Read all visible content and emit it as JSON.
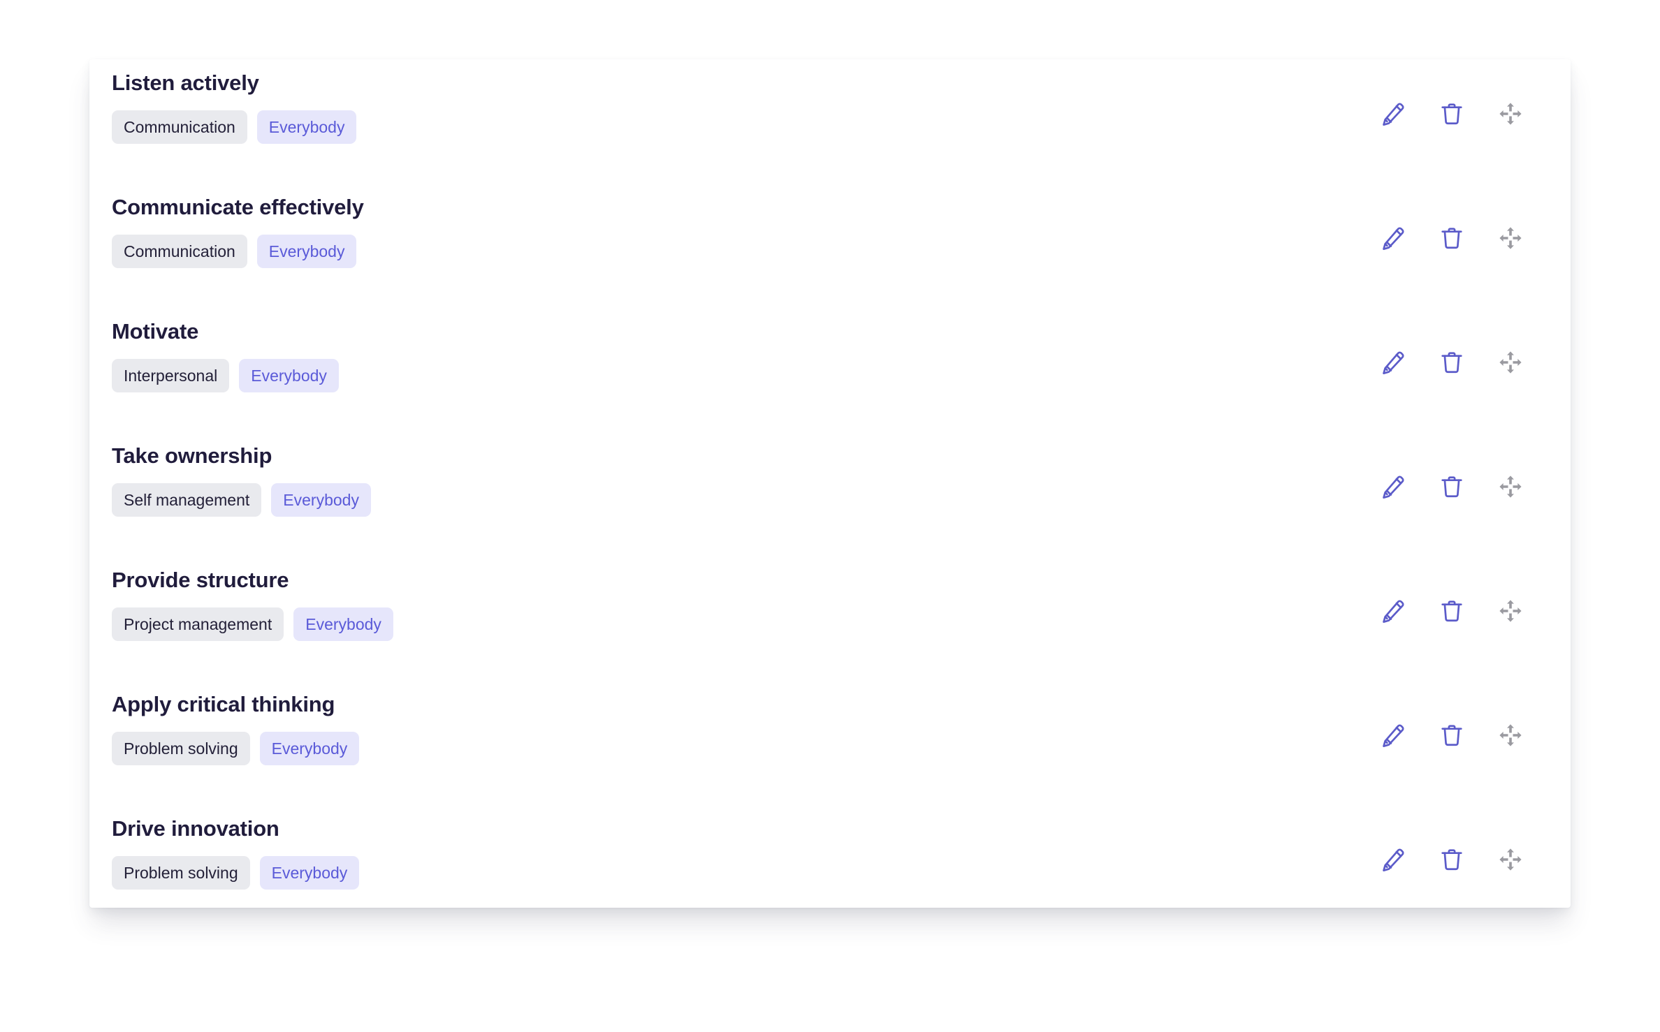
{
  "colors": {
    "page_background": "#ffffff",
    "card_background": "#ffffff",
    "title_text": "#201c3c",
    "tag_category_background": "#e9eaee",
    "tag_category_text": "#232038",
    "tag_audience_background": "#e6e6fb",
    "tag_audience_text": "#5a5ad8",
    "icon_accent": "#5b5bc9",
    "icon_muted": "#9a9aa0"
  },
  "actions": {
    "edit_label": "Edit",
    "delete_label": "Delete",
    "reorder_label": "Reorder"
  },
  "skills": [
    {
      "title": "Listen actively",
      "category": "Communication",
      "audience": "Everybody"
    },
    {
      "title": "Communicate effectively",
      "category": "Communication",
      "audience": "Everybody"
    },
    {
      "title": "Motivate",
      "category": "Interpersonal",
      "audience": "Everybody"
    },
    {
      "title": "Take ownership",
      "category": "Self management",
      "audience": "Everybody"
    },
    {
      "title": "Provide structure",
      "category": "Project management",
      "audience": "Everybody"
    },
    {
      "title": "Apply critical thinking",
      "category": "Problem solving",
      "audience": "Everybody"
    },
    {
      "title": "Drive innovation",
      "category": "Problem solving",
      "audience": "Everybody"
    }
  ]
}
